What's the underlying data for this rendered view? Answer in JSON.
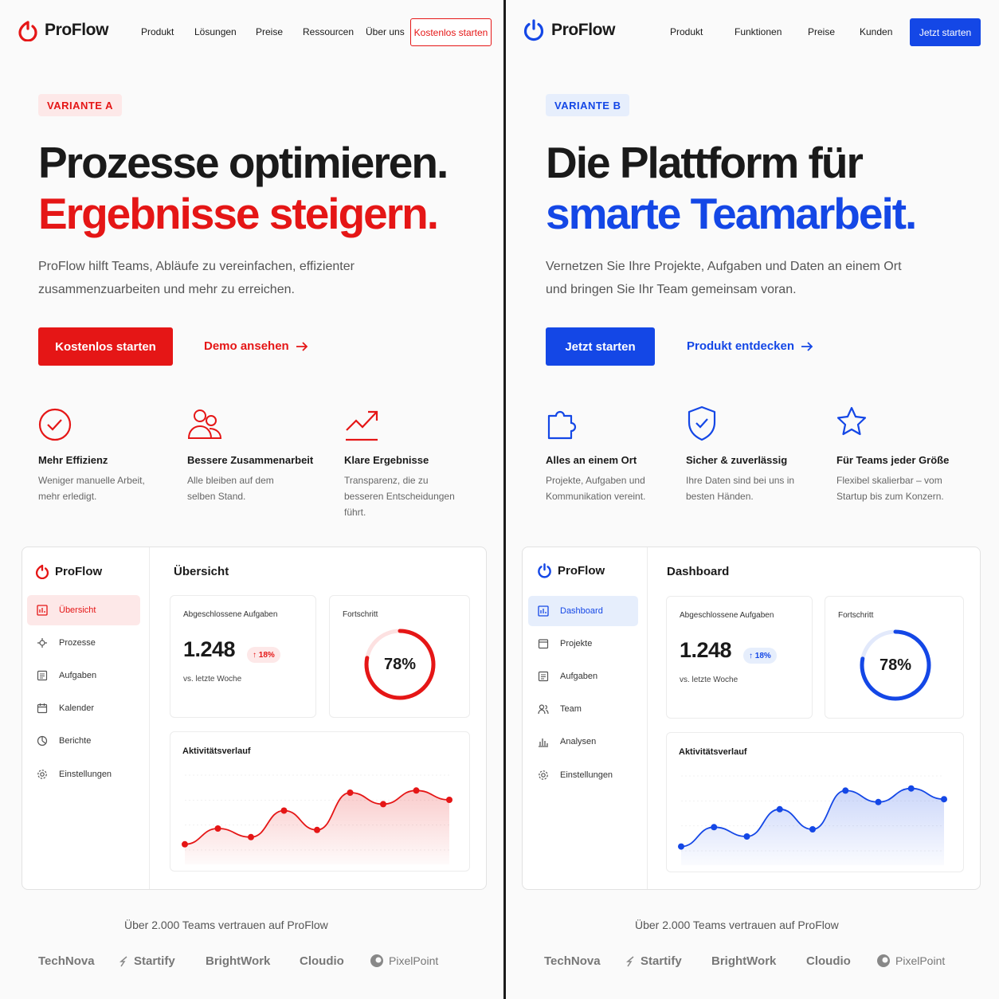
{
  "variant_a": {
    "logo": "ProFlow",
    "nav": [
      "Produkt",
      "Lösungen",
      "Preise",
      "Ressourcen",
      "Über uns"
    ],
    "nav_cta": "Kostenlos starten",
    "badge": "VARIANTE A",
    "headline_1": "Prozesse optimieren.",
    "headline_2": "Ergebnisse steigern.",
    "lead": "ProFlow hilft Teams, Abläufe zu vereinfachen, effizienter zusammenzuarbeiten und mehr zu erreichen.",
    "primary_button": "Kostenlos starten",
    "secondary_link": "Demo ansehen",
    "features": [
      {
        "icon": "check-circle-icon",
        "title": "Mehr Effizienz",
        "desc": "Weniger manuelle Arbeit, mehr erledigt."
      },
      {
        "icon": "users-icon",
        "title": "Bessere Zusammenarbeit",
        "desc": "Alle bleiben auf dem selben Stand."
      },
      {
        "icon": "trending-up-icon",
        "title": "Klare Ergebnisse",
        "desc": "Transparenz, die zu besseren Entscheidungen führt."
      }
    ],
    "dashboard": {
      "logo": "ProFlow",
      "title": "Übersicht",
      "sidebar": [
        {
          "icon": "overview-icon",
          "label": "Übersicht"
        },
        {
          "icon": "process-icon",
          "label": "Prozesse"
        },
        {
          "icon": "tasks-icon",
          "label": "Aufgaben"
        },
        {
          "icon": "calendar-icon",
          "label": "Kalender"
        },
        {
          "icon": "reports-icon",
          "label": "Berichte"
        },
        {
          "icon": "settings-icon",
          "label": "Einstellungen"
        }
      ],
      "stat_label": "Abgeschlossene Aufgaben",
      "stat_value": "1.248",
      "stat_delta": "↑ 18%",
      "stat_sub": "vs. letzte Woche",
      "progress_label": "Fortschritt",
      "progress_text": "78%",
      "progress_value": 0.78,
      "chart_title": "Aktivitätsverlauf"
    },
    "trust": "Über 2.000 Teams vertrauen auf ProFlow",
    "logos": [
      "TechNova",
      "Startify",
      "BrightWork",
      "Cloudio",
      "PixelPoint"
    ],
    "colors": {
      "accent": "#e51616",
      "accent_soft": "#fde8e8"
    }
  },
  "variant_b": {
    "logo": "ProFlow",
    "nav": [
      "Produkt",
      "Funktionen",
      "Preise",
      "Kunden"
    ],
    "nav_cta": "Jetzt starten",
    "badge": "VARIANTE B",
    "headline_1": "Die Plattform für",
    "headline_2": "smarte Teamarbeit.",
    "lead": "Vernetzen Sie Ihre Projekte, Aufgaben und Daten an einem Ort und bringen Sie Ihr Team gemeinsam voran.",
    "primary_button": "Jetzt starten",
    "secondary_link": "Produkt entdecken",
    "features": [
      {
        "icon": "puzzle-icon",
        "title": "Alles an einem Ort",
        "desc": "Projekte, Aufgaben und Kommunikation vereint."
      },
      {
        "icon": "shield-check-icon",
        "title": "Sicher & zuverlässig",
        "desc": "Ihre Daten sind bei uns in besten Händen."
      },
      {
        "icon": "star-icon",
        "title": "Für Teams jeder Größe",
        "desc": "Flexibel skalierbar – vom Startup bis zum Konzern."
      }
    ],
    "dashboard": {
      "logo": "ProFlow",
      "title": "Dashboard",
      "sidebar": [
        {
          "icon": "dashboard-icon",
          "label": "Dashboard"
        },
        {
          "icon": "projects-icon",
          "label": "Projekte"
        },
        {
          "icon": "tasks-icon",
          "label": "Aufgaben"
        },
        {
          "icon": "team-icon",
          "label": "Team"
        },
        {
          "icon": "analytics-icon",
          "label": "Analysen"
        },
        {
          "icon": "settings-icon",
          "label": "Einstellungen"
        }
      ],
      "stat_label": "Abgeschlossene Aufgaben",
      "stat_value": "1.248",
      "stat_delta": "↑ 18%",
      "stat_sub": "vs. letzte Woche",
      "progress_label": "Fortschritt",
      "progress_text": "78%",
      "progress_value": 0.78,
      "chart_title": "Aktivitätsverlauf"
    },
    "trust": "Über 2.000 Teams vertrauen auf ProFlow",
    "logos": [
      "TechNova",
      "Startify",
      "BrightWork",
      "Cloudio",
      "PixelPoint"
    ],
    "colors": {
      "accent": "#1447e6",
      "accent_soft": "#e6eefc"
    }
  },
  "chart_data": [
    {
      "type": "area",
      "title": "Aktivitätsverlauf",
      "x": [
        1,
        2,
        3,
        4,
        5,
        6,
        7,
        8,
        9,
        10
      ],
      "values": [
        8,
        30,
        18,
        55,
        28,
        80,
        64,
        83,
        70,
        0
      ],
      "series_valid_points": 9
    },
    {
      "type": "area",
      "title": "Aktivitätsverlauf",
      "x": [
        1,
        2,
        3,
        4,
        5,
        6,
        7,
        8,
        9,
        10
      ],
      "values": [
        6,
        33,
        20,
        58,
        30,
        84,
        68,
        87,
        72,
        0
      ],
      "series_valid_points": 9
    }
  ]
}
